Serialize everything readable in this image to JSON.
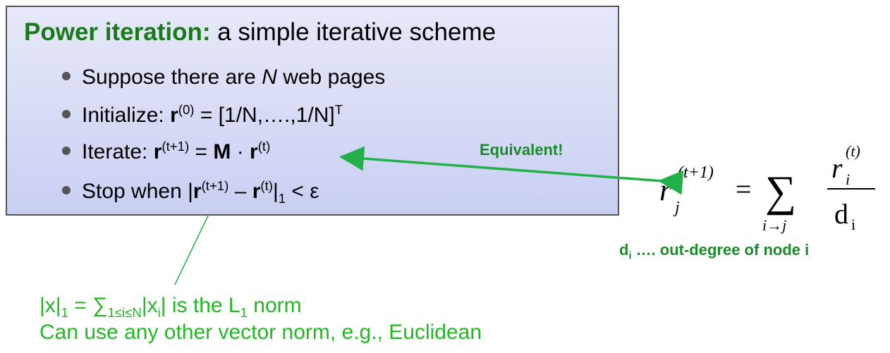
{
  "title": {
    "highlight": "Power iteration:",
    "rest": " a simple iterative scheme"
  },
  "bullets": {
    "b1": {
      "pre": "Suppose there are ",
      "var": "N",
      "post": " web pages"
    },
    "b2": {
      "pre": "Initialize: ",
      "r": "r",
      "sup1": "(0)",
      "mid": " = [1/N,….,1/N]",
      "sup2": "T"
    },
    "b3": {
      "pre": "Iterate: ",
      "r1": "r",
      "sup1": "(t+1)",
      "eq": " = ",
      "M": "M",
      "dot": " · ",
      "r2": "r",
      "sup2": "(t)"
    },
    "b4": {
      "pre": "Stop when |",
      "r1": "r",
      "sup1": "(t+1)",
      "minus": " – ",
      "r2": "r",
      "sup2": "(t)",
      "bar": "|",
      "sub": "1",
      "post": " < ε"
    }
  },
  "equivalent_label": "Equivalent!",
  "formula": {
    "lhs": "r",
    "lhs_sub": "j",
    "lhs_sup": "(t+1)",
    "eq": "=",
    "sum": "∑",
    "sum_sub": "i→j",
    "num": "r",
    "num_sub": "i",
    "num_sup": "(t)",
    "den": "d",
    "den_sub": "i"
  },
  "degree_note": {
    "d": "d",
    "sub": "i",
    "rest": " …. out-degree of node i"
  },
  "footnote": {
    "line1": {
      "a": "|x|",
      "a_sub": "1",
      "b": " = ∑",
      "b_sub": "1≤i≤N",
      "c": "|x",
      "c_sub": "i",
      "d": "| is the L",
      "d_sub": "1",
      "e": " norm"
    },
    "line2": "Can use any other vector norm, e.g., Euclidean"
  },
  "colors": {
    "title_green": "#1a7a1a",
    "arrow_green": "#22b04a",
    "foot_green": "#22b822",
    "box_fill": "#c9cff2"
  }
}
